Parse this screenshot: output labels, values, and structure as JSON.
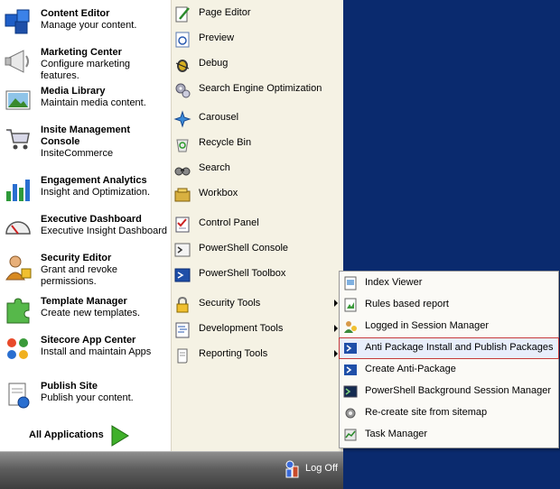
{
  "left_items": [
    {
      "title": "Content Editor",
      "desc": "Manage your content.",
      "icon": "content-editor-icon"
    },
    {
      "title": "Marketing Center",
      "desc": "Configure marketing features.",
      "icon": "megaphone-icon"
    },
    {
      "title": "Media Library",
      "desc": "Maintain media content.",
      "icon": "media-library-icon"
    },
    {
      "title": "Insite Management Console",
      "desc": "InsiteCommerce",
      "icon": "shopping-cart-icon"
    },
    {
      "title": "Engagement Analytics",
      "desc": "Insight and Optimization.",
      "icon": "bar-chart-icon"
    },
    {
      "title": "Executive Dashboard",
      "desc": "Executive Insight Dashboard",
      "icon": "gauge-icon"
    },
    {
      "title": "Security Editor",
      "desc": "Grant and revoke permissions.",
      "icon": "security-user-icon"
    },
    {
      "title": "Template Manager",
      "desc": "Create new templates.",
      "icon": "puzzle-icon"
    },
    {
      "title": "Sitecore App Center",
      "desc": "Install and maintain Apps",
      "icon": "app-center-icon"
    },
    {
      "title": "Publish Site",
      "desc": "Publish your content.",
      "icon": "publish-icon"
    }
  ],
  "all_applications": "All Applications",
  "right_items": [
    {
      "label": "Page Editor",
      "icon": "page-editor-icon",
      "submenu": false
    },
    {
      "label": "Preview",
      "icon": "preview-icon",
      "submenu": false
    },
    {
      "label": "Debug",
      "icon": "bug-icon",
      "submenu": false
    },
    {
      "label": "Search Engine Optimization",
      "icon": "gears-icon",
      "submenu": false
    },
    {
      "label": "Carousel",
      "icon": "carousel-icon",
      "submenu": false
    },
    {
      "label": "Recycle Bin",
      "icon": "recycle-bin-icon",
      "submenu": false
    },
    {
      "label": "Search",
      "icon": "binoculars-icon",
      "submenu": false
    },
    {
      "label": "Workbox",
      "icon": "workbox-icon",
      "submenu": false
    },
    {
      "label": "Control Panel",
      "icon": "checklist-icon",
      "submenu": false
    },
    {
      "label": "PowerShell Console",
      "icon": "terminal-icon",
      "submenu": false
    },
    {
      "label": "PowerShell Toolbox",
      "icon": "powershell-icon",
      "submenu": false
    },
    {
      "label": "Security Tools",
      "icon": "padlock-icon",
      "submenu": true
    },
    {
      "label": "Development Tools",
      "icon": "code-file-icon",
      "submenu": true
    },
    {
      "label": "Reporting Tools",
      "icon": "scroll-icon",
      "submenu": true
    }
  ],
  "logoff": "Log Off",
  "submenu_items": [
    {
      "label": "Index Viewer",
      "icon": "index-viewer-icon",
      "selected": false
    },
    {
      "label": "Rules based report",
      "icon": "rules-report-icon",
      "selected": false
    },
    {
      "label": "Logged in Session Manager",
      "icon": "session-manager-icon",
      "selected": false
    },
    {
      "label": "Anti Package Install and Publish Packages",
      "icon": "powershell-icon",
      "selected": true
    },
    {
      "label": "Create Anti-Package",
      "icon": "powershell-icon",
      "selected": false
    },
    {
      "label": "PowerShell Background Session Manager",
      "icon": "terminal-icon",
      "selected": false
    },
    {
      "label": "Re-create site from sitemap",
      "icon": "gear-icon",
      "selected": false
    },
    {
      "label": "Task Manager",
      "icon": "task-manager-icon",
      "selected": false
    }
  ],
  "colors": {
    "desktop": "#0a2a6e",
    "right_pane": "#f5f2e4",
    "selection_outline": "#c63a3a",
    "selection_bg": "#e8eefb"
  }
}
